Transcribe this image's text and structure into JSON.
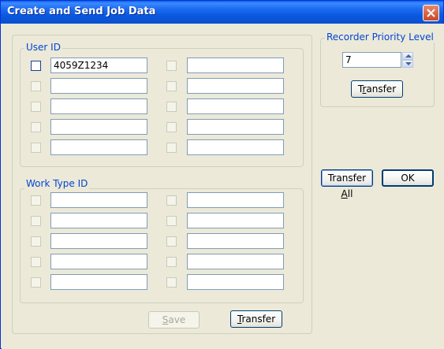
{
  "window": {
    "title": "Create and Send Job Data"
  },
  "user_id": {
    "label": "User ID",
    "left": [
      "4059Z1234",
      "",
      "",
      "",
      ""
    ],
    "right": [
      "",
      "",
      "",
      "",
      ""
    ]
  },
  "work_type_id": {
    "label": "Work Type ID",
    "left": [
      "",
      "",
      "",
      "",
      ""
    ],
    "right": [
      "",
      "",
      "",
      "",
      ""
    ]
  },
  "buttons": {
    "save_mnemonic": "S",
    "save_rest": "ave",
    "transfer_mnemonic": "T",
    "transfer_rest": "ransfer",
    "rpl_transfer_pre": "T",
    "rpl_transfer_mnemonic": "r",
    "rpl_transfer_rest": "ansfer",
    "transfer_all_pre": "Transfer ",
    "transfer_all_mnemonic": "A",
    "transfer_all_rest": "ll",
    "ok": "OK"
  },
  "recorder_priority": {
    "label": "Recorder Priority Level",
    "value": "7"
  },
  "colors": {
    "titlebar": "#0A58DE",
    "group_label": "#0046D5",
    "face": "#ECE9D8"
  }
}
